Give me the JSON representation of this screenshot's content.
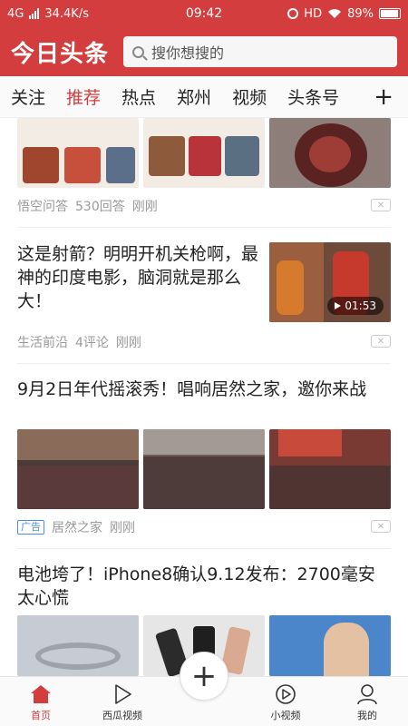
{
  "status": {
    "network": "4G",
    "speed": "34.4K/s",
    "time": "09:42",
    "hd": "HD",
    "battery": "89%"
  },
  "header": {
    "logo": "今日头条",
    "search_placeholder": "搜你想搜的"
  },
  "tabs": [
    "关注",
    "推荐",
    "热点",
    "郑州",
    "视频",
    "头条号"
  ],
  "tabs_add": "+",
  "feed": [
    {
      "meta_source": "悟空问答",
      "meta_count": "530回答",
      "meta_time": "刚刚"
    },
    {
      "title": "这是射箭？明明开机关枪啊，最神的印度电影，脑洞就是那么大！",
      "duration": "01:53",
      "meta_source": "生活前沿",
      "meta_count": "4评论",
      "meta_time": "刚刚"
    },
    {
      "title": "9月2日年代摇滚秀！唱响居然之家，邀你来战",
      "ad_label": "广告",
      "meta_source": "居然之家",
      "meta_time": "刚刚"
    },
    {
      "title": "电池垮了！iPhone8确认9.12发布：2700毫安太心慌"
    }
  ],
  "bottom_nav": [
    {
      "label": "首页",
      "icon": "home-icon"
    },
    {
      "label": "西瓜视频",
      "icon": "play-icon"
    },
    {
      "label": "",
      "icon": "plus-icon"
    },
    {
      "label": "小视频",
      "icon": "small-video-icon"
    },
    {
      "label": "我的",
      "icon": "profile-icon"
    }
  ],
  "colors": {
    "brand": "#d43d3d",
    "tab_active": "#d43d3d",
    "meta": "#999999",
    "ad": "#4a90e2"
  }
}
